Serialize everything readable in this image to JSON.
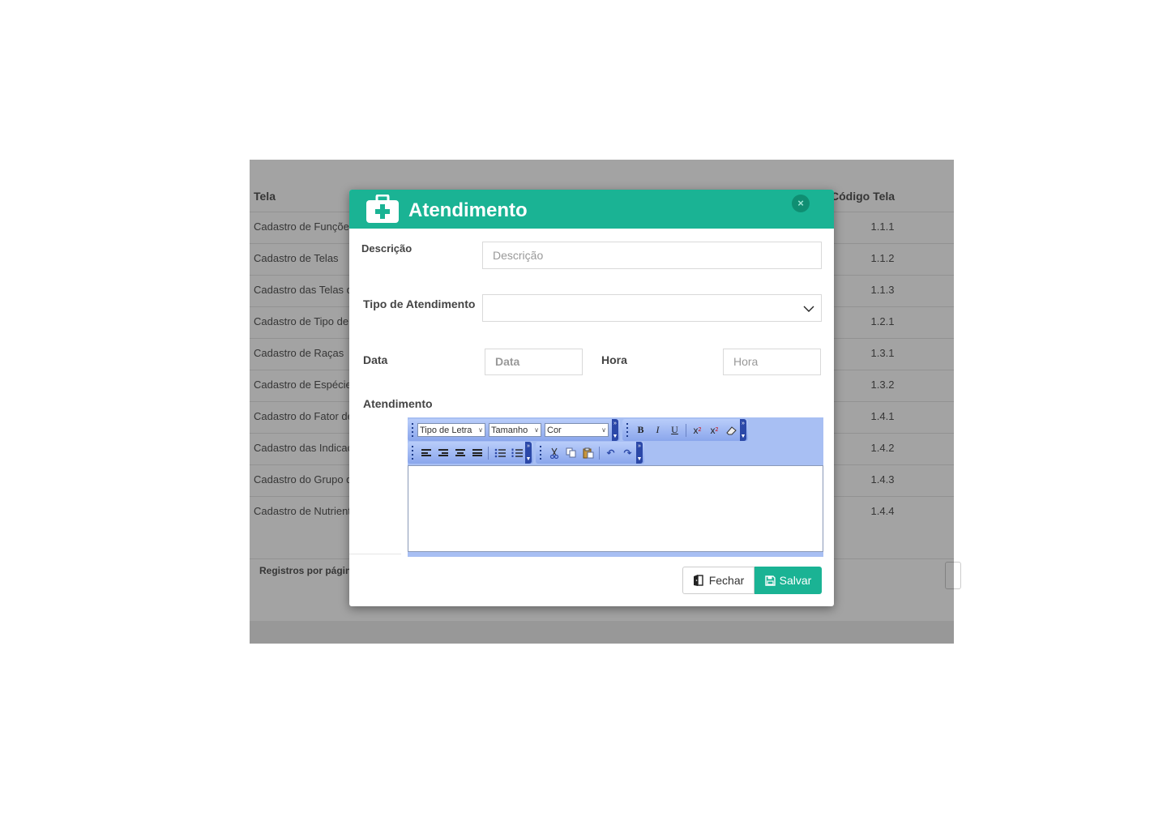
{
  "background": {
    "columns": {
      "tela": "Tela",
      "codigo": "Código Tela"
    },
    "rows": [
      {
        "name": "Cadastro de Funções",
        "code": "1.1.1"
      },
      {
        "name": "Cadastro de Telas",
        "code": "1.1.2"
      },
      {
        "name": "Cadastro das Telas do",
        "code": "1.1.3"
      },
      {
        "name": "Cadastro de Tipo de",
        "code": "1.2.1"
      },
      {
        "name": "Cadastro de Raças",
        "code": "1.3.1"
      },
      {
        "name": "Cadastro de Espécies",
        "code": "1.3.2"
      },
      {
        "name": "Cadastro do Fator de",
        "code": "1.4.1"
      },
      {
        "name": "Cadastro das Indicações",
        "code": "1.4.2"
      },
      {
        "name": "Cadastro do Grupo de",
        "code": "1.4.3"
      },
      {
        "name": "Cadastro de Nutrientes",
        "code": "1.4.4"
      }
    ],
    "registros_label": "Registros por página"
  },
  "modal": {
    "title": "Atendimento",
    "close_label": "×",
    "descricao": {
      "label": "Descrição",
      "placeholder": "Descrição",
      "value": ""
    },
    "tipo": {
      "label": "Tipo de Atendimento",
      "value": ""
    },
    "data": {
      "label": "Data",
      "placeholder": "Data",
      "value": ""
    },
    "hora": {
      "label": "Hora",
      "placeholder": "Hora",
      "value": ""
    },
    "atendimento_label": "Atendimento",
    "editor": {
      "font_select": "Tipo de Letra",
      "size_select": "Tamanho",
      "color_select": "Cor",
      "bold": "B",
      "italic": "I",
      "underline": "U",
      "content": ""
    },
    "buttons": {
      "fechar": "Fechar",
      "salvar": "Salvar"
    }
  },
  "colors": {
    "accent": "#1ab394",
    "editor_toolbar": "#a8bff3"
  }
}
